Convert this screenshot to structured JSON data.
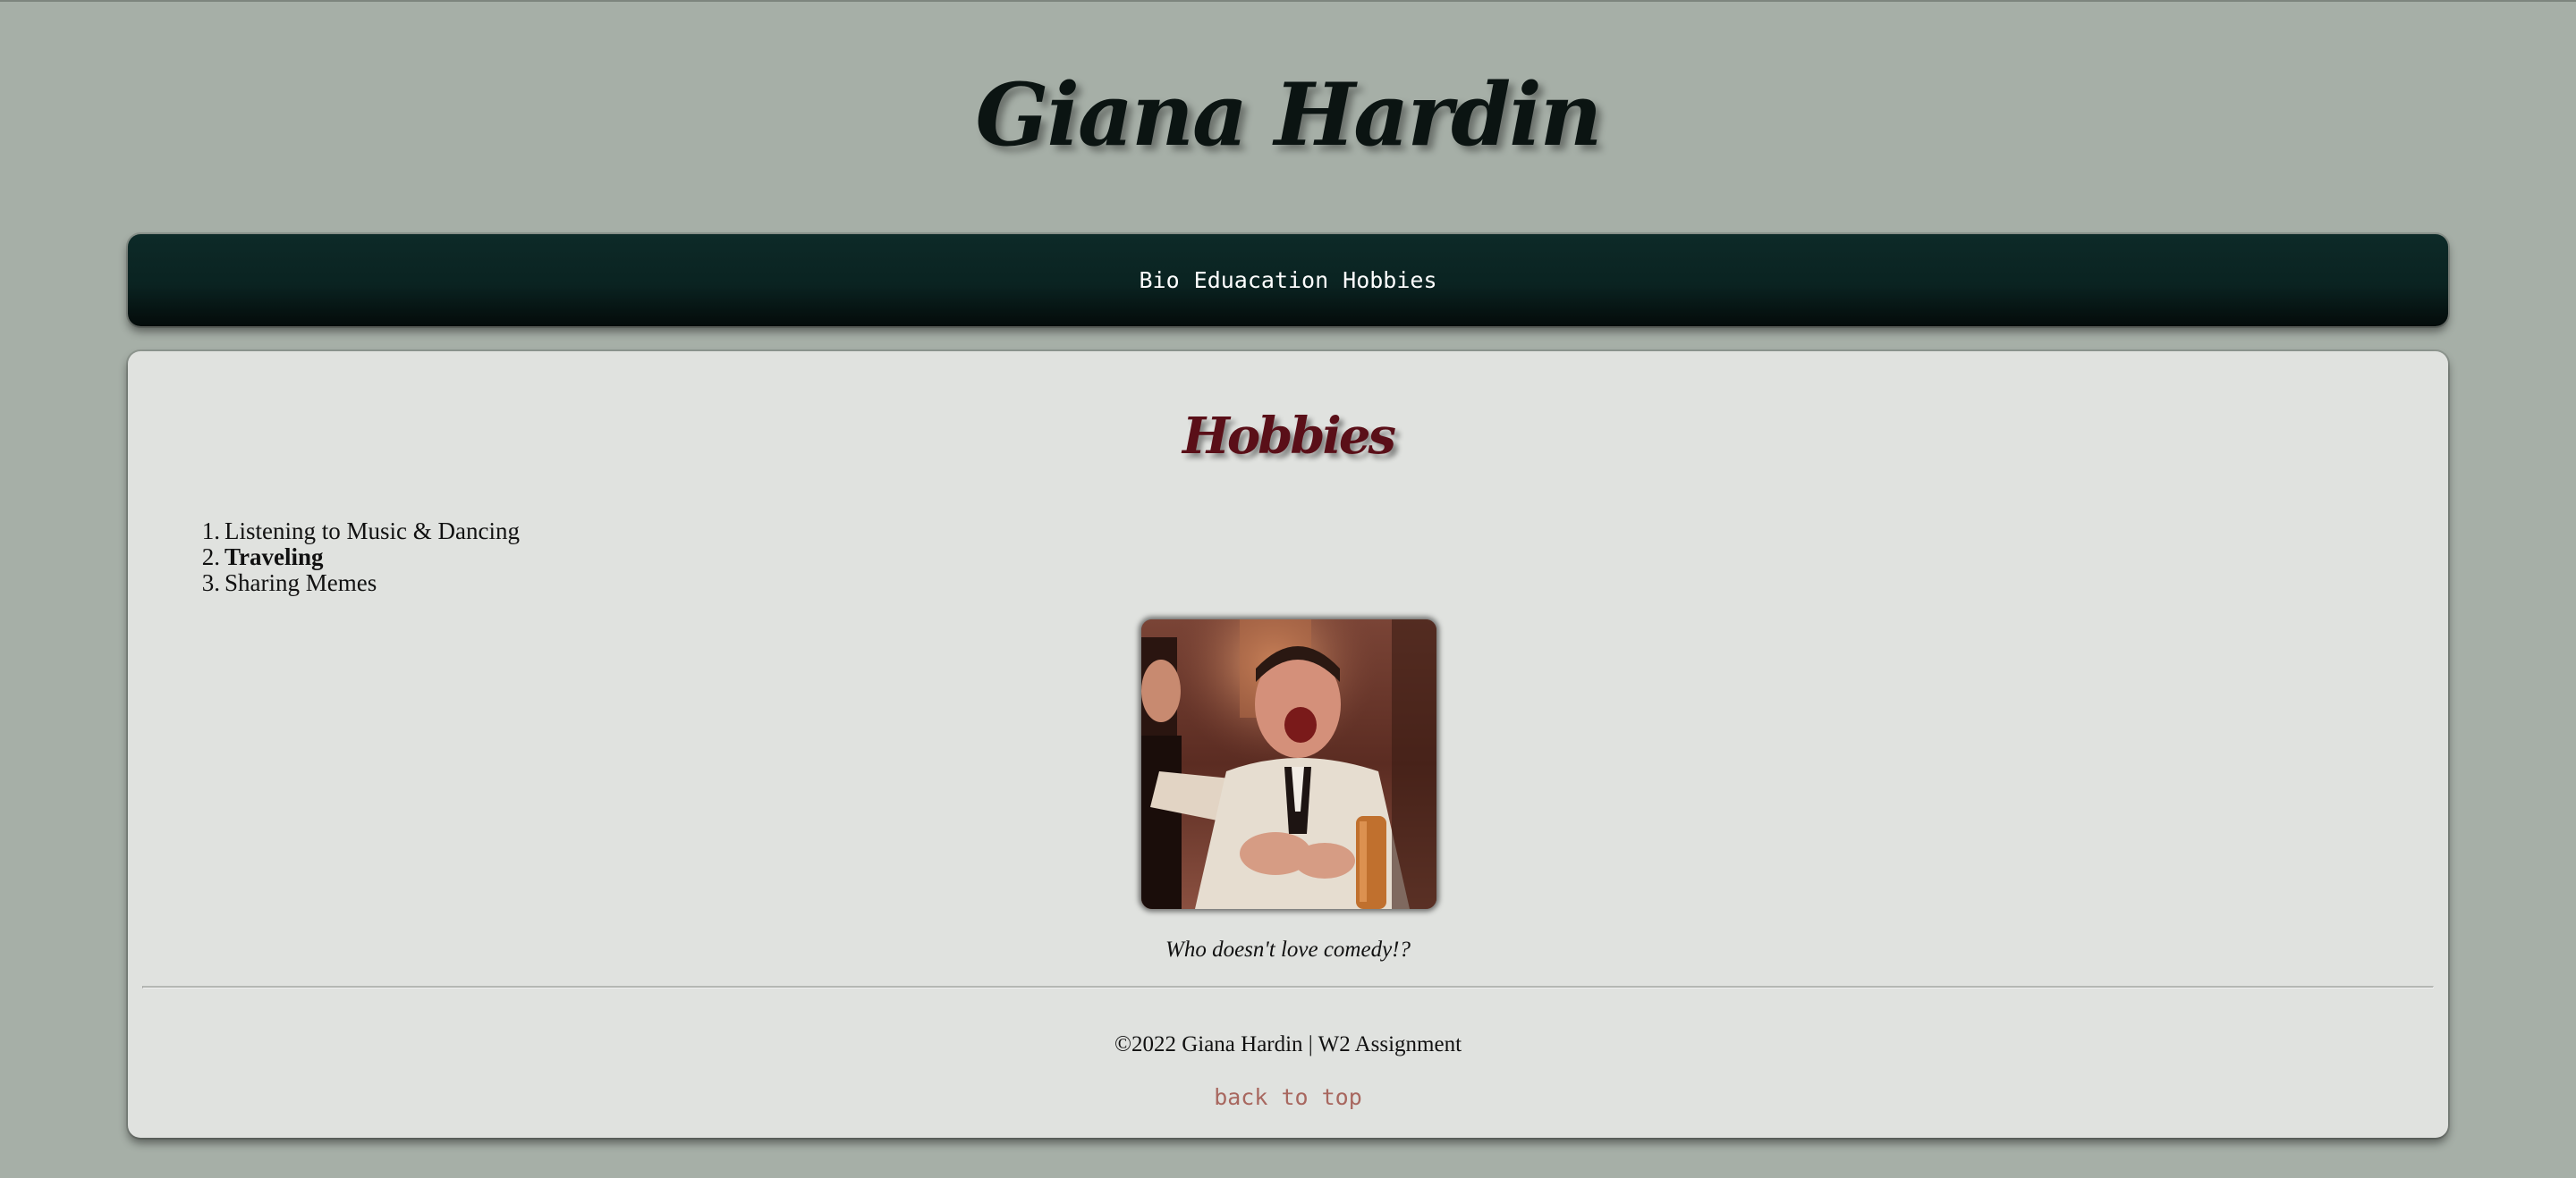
{
  "header": {
    "title": "Giana Hardin"
  },
  "nav": {
    "items": [
      "Bio",
      "Eduacation",
      "Hobbies"
    ]
  },
  "main": {
    "heading": "Hobbies",
    "hobbies": [
      "Listening to Music & Dancing",
      "Traveling",
      "Sharing Memes"
    ],
    "hobby_numbers": [
      "1.",
      "2.",
      "3."
    ],
    "image_caption": "Who doesn't love comedy!?"
  },
  "footer": {
    "copyright": "©2022 Giana Hardin | W2 Assignment",
    "back_to_top": "back to top"
  },
  "colors": {
    "page_background": "#a6afa7",
    "nav_background": "#0a2321",
    "content_background": "#e0e2df",
    "heading_color": "#5a0f18",
    "link_color": "#a8675f"
  }
}
